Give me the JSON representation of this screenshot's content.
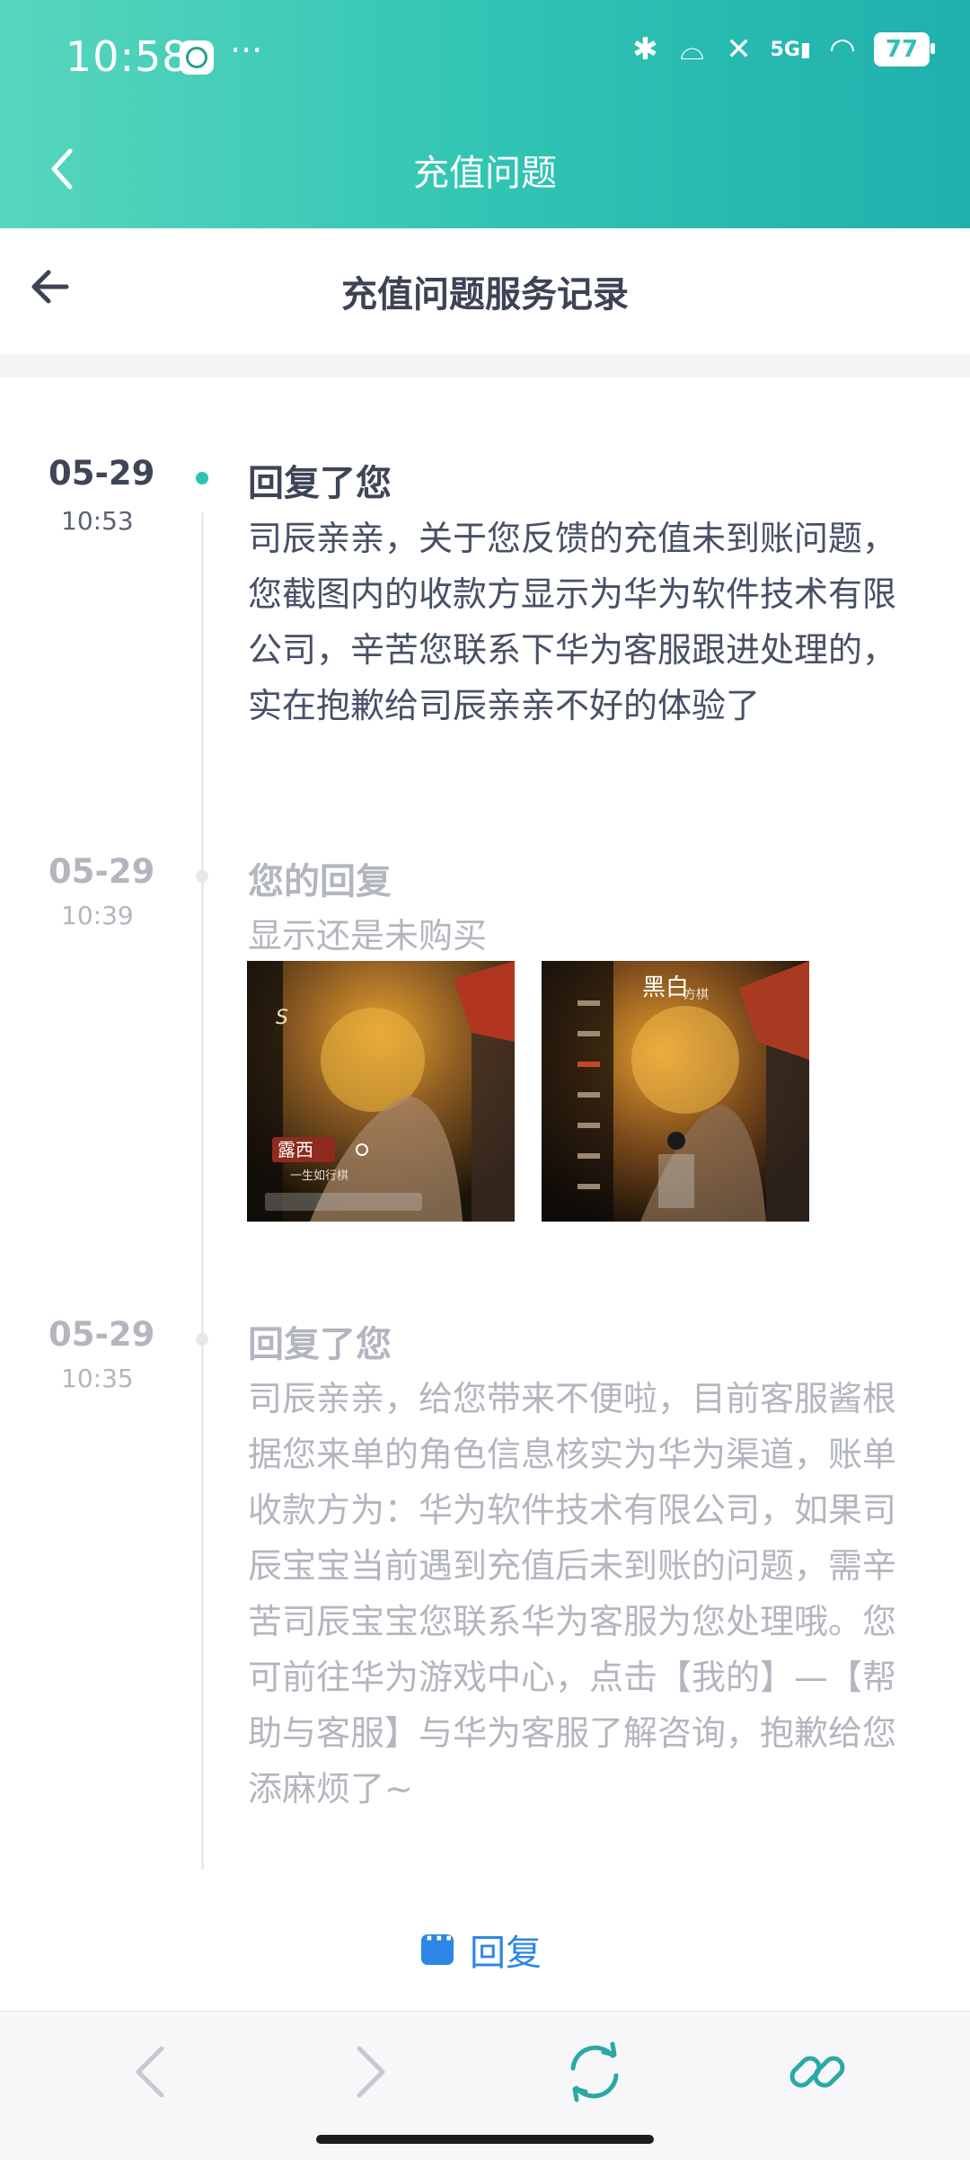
{
  "status_bar": {
    "time": "10:58",
    "dots": "···",
    "battery": "77",
    "network": "5G"
  },
  "top_bar": {
    "title": "充值问题"
  },
  "sub_header": {
    "title": "充值问题服务记录"
  },
  "records": [
    {
      "date": "05-29",
      "time": "10:53",
      "title": "回复了您",
      "content": "司辰亲亲，关于您反馈的充值未到账问题，您截图内的收款方显示为华为软件技术有限公司，辛苦您联系下华为客服跟进处理的，实在抱歉给司辰亲亲不好的体验了"
    },
    {
      "date": "05-29",
      "time": "10:39",
      "title": "您的回复",
      "content": "显示还是未购买",
      "images": [
        {
          "text": "露西",
          "subtext": "一生如行棋",
          "label": "S"
        },
        {
          "text": "黑白",
          "subtext": "方棋"
        }
      ]
    },
    {
      "date": "05-29",
      "time": "10:35",
      "title": "回复了您",
      "content": "司辰亲亲，给您带来不便啦，目前客服酱根据您来单的角色信息核实为华为渠道，账单收款方为：华为软件技术有限公司，如果司辰宝宝当前遇到充值后未到账的问题，需辛苦司辰宝宝您联系华为客服为您处理哦。您可前往华为游戏中心，点击【我的】—【帮助与客服】与华为客服了解咨询，抱歉给您添麻烦了~"
    }
  ],
  "reply_button": {
    "label": "回复"
  },
  "colors": {
    "accent_teal": "#2ec3b3",
    "reply_blue": "#2c86e6",
    "nav_teal": "#2aa9a6"
  }
}
